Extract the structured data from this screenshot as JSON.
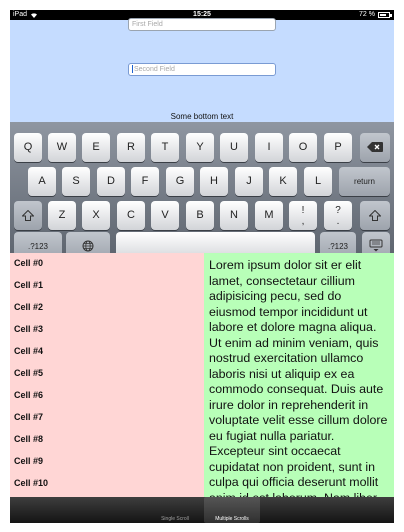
{
  "status_bar": {
    "device": "iPad",
    "time": "15:25",
    "battery": "72 %",
    "battery_level": 0.72
  },
  "form": {
    "first_field_placeholder": "First Field",
    "second_field_placeholder": "Second Field",
    "bottom_text": "Some bottom text"
  },
  "keyboard": {
    "row1": [
      "Q",
      "W",
      "E",
      "R",
      "T",
      "Y",
      "U",
      "I",
      "O",
      "P"
    ],
    "row2": [
      "A",
      "S",
      "D",
      "F",
      "G",
      "H",
      "J",
      "K",
      "L"
    ],
    "row3": [
      "Z",
      "X",
      "C",
      "V",
      "B",
      "N",
      "M"
    ],
    "exclaim": "!",
    "comma": ",",
    "question": "?",
    "period": ".",
    "return_label": "return",
    "numbers_label": ".?123",
    "icons": {
      "delete": "backspace-icon",
      "shift": "shift-icon",
      "globe": "globe-icon",
      "hide": "keyboard-hide-icon"
    }
  },
  "cells": [
    "Cell #0",
    "Cell #1",
    "Cell #2",
    "Cell #3",
    "Cell #4",
    "Cell #5",
    "Cell #6",
    "Cell #7",
    "Cell #8",
    "Cell #9",
    "Cell #10"
  ],
  "lorem_text": "Lorem ipsum dolor sit er elit lamet, consectetaur cillium adipisicing pecu, sed do eiusmod tempor incididunt ut labore et dolore magna aliqua. Ut enim ad minim veniam, quis nostrud exercitation ullamco laboris nisi ut aliquip ex ea commodo consequat. Duis aute irure dolor in reprehenderit in voluptate velit esse cillum dolore eu fugiat nulla pariatur. Excepteur sint occaecat cupidatat non proident, sunt in culpa qui officia deserunt mollit anim id est laborum. Nam liber",
  "tabs": {
    "single": "Single Scroll",
    "multiple": "Multiple Scrolls"
  },
  "colors": {
    "top_background": "#c5dcff",
    "left_pane": "#ffd6d5",
    "right_pane": "#b8ffb8"
  }
}
